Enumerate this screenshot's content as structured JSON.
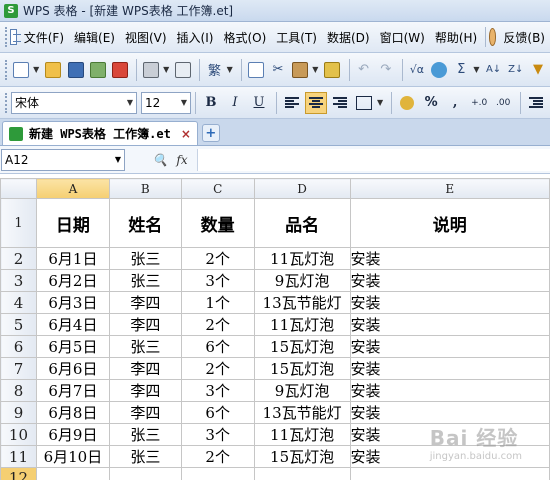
{
  "window": {
    "title": "WPS 表格 - [新建 WPS表格 工作簿.et]",
    "logo_letter": "S"
  },
  "menu": {
    "items": [
      "文件(F)",
      "编辑(E)",
      "视图(V)",
      "插入(I)",
      "格式(O)",
      "工具(T)",
      "数据(D)",
      "窗口(W)",
      "帮助(H)"
    ],
    "feedback": "反馈(B)"
  },
  "toolbar_format": {
    "font_name": "宋体",
    "font_size": "12",
    "bold": "B",
    "italic": "I",
    "underline": "U",
    "percent": "%",
    "thousands": ","
  },
  "tabs": {
    "document": "新建 WPS表格 工作簿.et",
    "close": "×",
    "new": "+"
  },
  "formula_bar": {
    "cell_ref": "A12",
    "fx": "fx"
  },
  "sheet": {
    "columns": [
      "A",
      "B",
      "C",
      "D",
      "E"
    ],
    "header_row": {
      "row_no": "1",
      "cells": [
        "日期",
        "姓名",
        "数量",
        "品名",
        "说明"
      ]
    },
    "rows": [
      {
        "no": "2",
        "cells": [
          "6月1日",
          "张三",
          "2个",
          "11瓦灯泡",
          "安装"
        ]
      },
      {
        "no": "3",
        "cells": [
          "6月2日",
          "张三",
          "3个",
          "9瓦灯泡",
          "安装"
        ]
      },
      {
        "no": "4",
        "cells": [
          "6月3日",
          "李四",
          "1个",
          "13瓦节能灯",
          "安装"
        ]
      },
      {
        "no": "5",
        "cells": [
          "6月4日",
          "李四",
          "2个",
          "11瓦灯泡",
          "安装"
        ]
      },
      {
        "no": "6",
        "cells": [
          "6月5日",
          "张三",
          "6个",
          "15瓦灯泡",
          "安装"
        ]
      },
      {
        "no": "7",
        "cells": [
          "6月6日",
          "李四",
          "2个",
          "15瓦灯泡",
          "安装"
        ]
      },
      {
        "no": "8",
        "cells": [
          "6月7日",
          "李四",
          "3个",
          "9瓦灯泡",
          "安装"
        ]
      },
      {
        "no": "9",
        "cells": [
          "6月8日",
          "李四",
          "6个",
          "13瓦节能灯",
          "安装"
        ]
      },
      {
        "no": "10",
        "cells": [
          "6月9日",
          "张三",
          "3个",
          "11瓦灯泡",
          "安装"
        ]
      },
      {
        "no": "11",
        "cells": [
          "6月10日",
          "张三",
          "2个",
          "15瓦灯泡",
          "安装"
        ]
      }
    ],
    "empty_row_no": "12",
    "selected_column": "A",
    "selected_row": "12"
  },
  "watermark": {
    "text": "Bai 经验",
    "sub": "jingyan.baidu.com"
  },
  "colors": {
    "selection_gold": "#f5cf72",
    "toolbar_blue": "#dce6f3",
    "app_green": "#2e9a3a"
  }
}
